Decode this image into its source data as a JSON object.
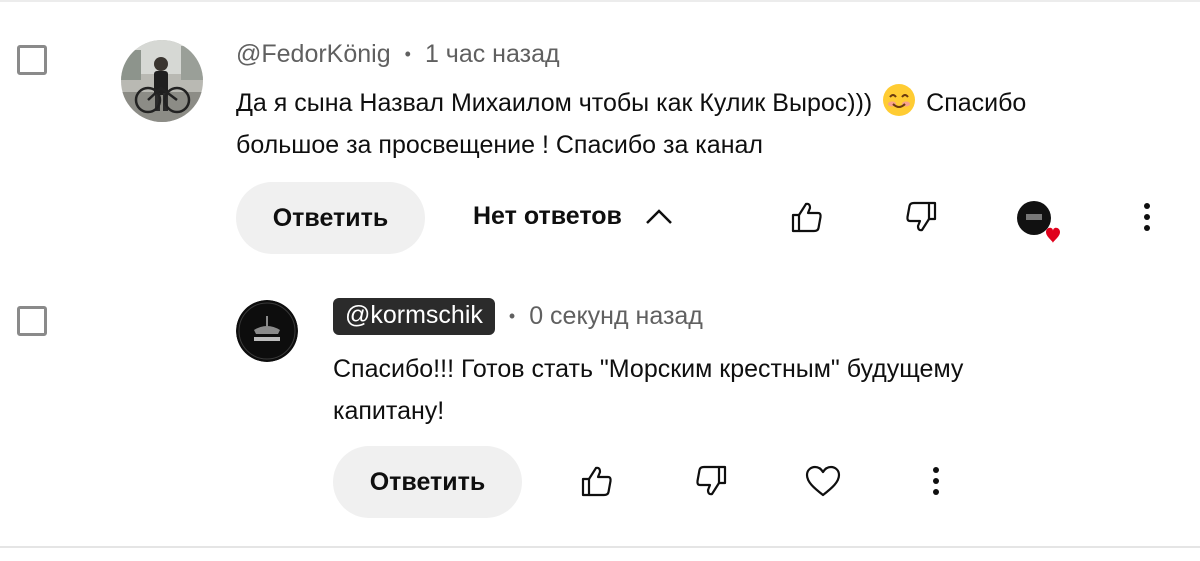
{
  "comments": [
    {
      "author": "@FedorKönig",
      "time": "1 час назад",
      "text_line1_a": "Да я сына Назвал Михаилом чтобы как Кулик Вырос)))",
      "text_line1_b": "Спасибо",
      "text_line2": "большое за просвещение ! Спасибо за канал",
      "emoji": "smiling-face-emoji",
      "reply_label": "Ответить",
      "replies_toggle_label": "Нет ответов"
    }
  ],
  "reply": {
    "author": "@kormschik",
    "time": "0 секунд назад",
    "text_line1": "Спасибо!!! Готов стать \"Морским крестным\" будущему",
    "text_line2": "капитану!",
    "reply_label": "Ответить"
  },
  "icons": {
    "like": "thumbs-up-icon",
    "dislike": "thumbs-down-icon",
    "heart": "heart-icon",
    "more": "more-vertical-icon",
    "chevron": "chevron-up-icon"
  },
  "colors": {
    "heart_red": "#e0001b",
    "author_pill": "#2b2b2b",
    "pill_bg": "#f0f0f0"
  }
}
